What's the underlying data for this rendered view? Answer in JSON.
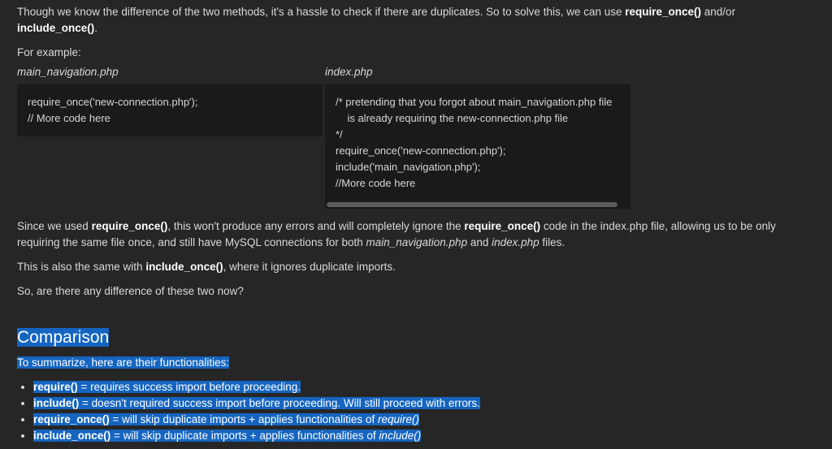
{
  "intro": {
    "t1": "Though we know the difference of the two methods, it's a hassle to check if there are duplicates. So to solve this, we can use ",
    "k1": "require_once()",
    "t2": " and/or ",
    "k2": "include_once()",
    "t3": "."
  },
  "for_example": "For example:",
  "files": {
    "left": {
      "label": "main_navigation.php",
      "code": "require_once('new-connection.php');\n// More code here"
    },
    "right": {
      "label": "index.php",
      "code": "/* pretending that you forgot about main_navigation.php file\n    is already requiring the new-connection.php file\n*/\nrequire_once('new-connection.php');\ninclude('main_navigation.php');\n//More code here"
    }
  },
  "explain": {
    "t1": "Since we used ",
    "k1": "require_once()",
    "t2": ", this won't produce any errors and will completely ignore the ",
    "k2": "require_once()",
    "t3": " code in the index.php file, allowing us to be only requiring the same file once, and still have MySQL connections for both ",
    "f1": "main_navigation.php",
    "t4": " and ",
    "f2": "index.php",
    "t5": " files."
  },
  "also": {
    "t1": "This is also the same with ",
    "k1": "include_once()",
    "t2": ", where it ignores duplicate imports."
  },
  "question": "So, are there any difference of these two now?",
  "comparison": {
    "heading": "Comparison",
    "summary": "To summarize, here are their functionalities:",
    "items": [
      {
        "fn": "require()",
        "desc": " = requires success import before proceeding."
      },
      {
        "fn": "include()",
        "desc": " = doesn't required success import before proceeding. Will still proceed with errors."
      },
      {
        "fn": "require_once()",
        "desc": " = will skip duplicate imports + applies functionalities of ",
        "ref": "require()"
      },
      {
        "fn": "include_once()",
        "desc": " = will skip duplicate imports + applies functionalities of ",
        "ref": "include()"
      }
    ]
  },
  "colors": {
    "background": "#262626",
    "code_bg": "#1a1a1a",
    "selection": "#1565c0"
  }
}
